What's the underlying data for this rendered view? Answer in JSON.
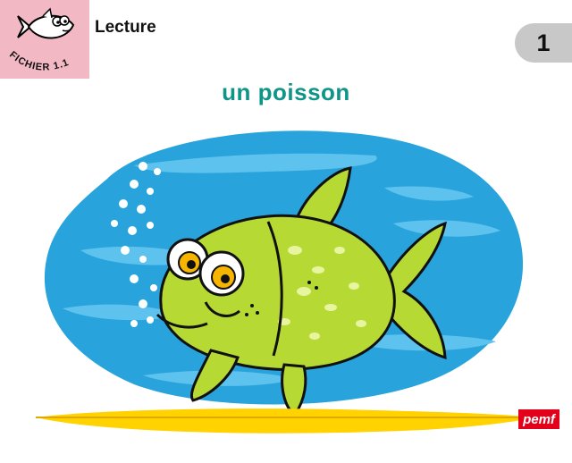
{
  "header": {
    "series_label": "FICHIER 1.1",
    "section_title": "Lecture",
    "page_number": "1"
  },
  "main": {
    "word_title": "un poisson",
    "illustration_icon": "fish-illustration"
  },
  "footer": {
    "publisher_logo_text": "pemf"
  },
  "colors": {
    "title_teal": "#0f9488",
    "logo_pink": "#f2b8c4",
    "badge_gray": "#c8c8c8",
    "water_blue": "#29a3dc",
    "fish_green": "#b6d934",
    "sand_yellow": "#ffd200",
    "publisher_red": "#e3001b"
  }
}
